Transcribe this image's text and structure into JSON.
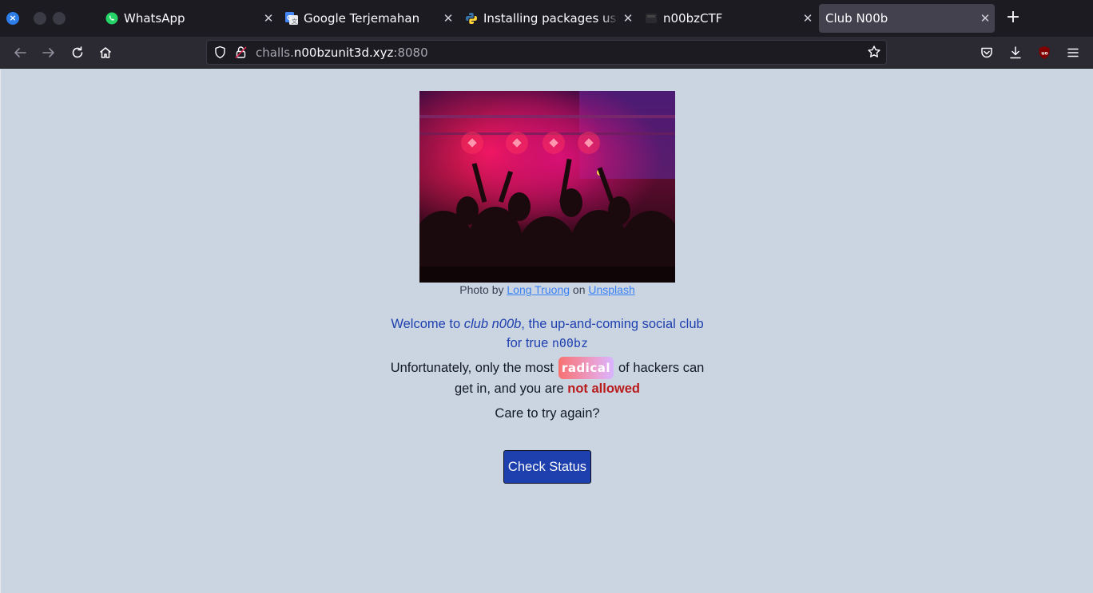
{
  "browser": {
    "tabs": [
      {
        "title": "WhatsApp",
        "icon": "whatsapp-icon",
        "active": false
      },
      {
        "title": "Google Terjemahan",
        "icon": "google-translate-icon",
        "active": false
      },
      {
        "title": "Installing packages using pip",
        "icon": "python-icon",
        "active": false
      },
      {
        "title": "n00bzCTF",
        "icon": "site-icon",
        "active": false
      },
      {
        "title": "Club N00b",
        "icon": "none",
        "active": true
      }
    ],
    "url": {
      "prefix": "challs.",
      "domain": "n00bzunit3d.xyz",
      "port": ":8080"
    }
  },
  "page": {
    "photo_credit": {
      "prefix": "Photo by ",
      "author": "Long Truong",
      "middle": " on ",
      "site": "Unsplash"
    },
    "welcome": {
      "part1": "Welcome to ",
      "club": "club n00b",
      "part2": ", the up-and-coming social club for true ",
      "code": "n00bz"
    },
    "status": {
      "part1": "Unfortunately, only the most",
      "badge": "radical",
      "part2": "of hackers can get in, and you are ",
      "verdict": "not allowed"
    },
    "prompt": "Care to try again?",
    "button_label": "Check Status"
  },
  "colors": {
    "background": "#cbd5e1",
    "heading_blue": "#1e40af",
    "not_allowed_red": "#b91c1c",
    "button_bg": "#1e40af"
  }
}
